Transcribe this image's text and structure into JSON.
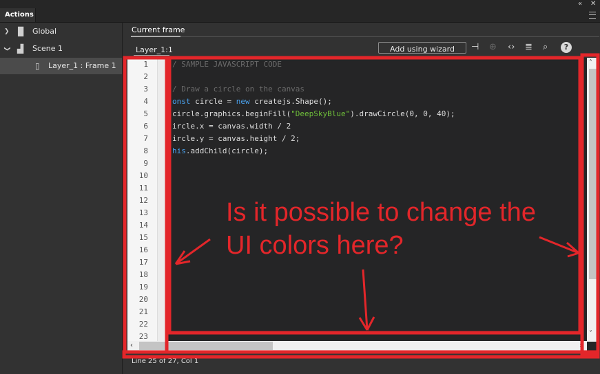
{
  "panel": {
    "tab_label": "Actions",
    "collapse_icon": "«",
    "close_icon": "✕"
  },
  "tree": {
    "items": [
      {
        "label": "Global",
        "chevron": "❯",
        "icon": "document-icon"
      },
      {
        "label": "Scene 1",
        "chevron": "❯",
        "icon": "clapperboard-icon"
      },
      {
        "label": "Layer_1 : Frame 1",
        "icon": "frame-icon"
      }
    ]
  },
  "editor": {
    "tab_label": "Current frame",
    "layer_label": "Layer_1:1",
    "wizard_label": "Add using wizard",
    "help_label": "?",
    "line_numbers": [
      "1",
      "2",
      "3",
      "4",
      "5",
      "6",
      "7",
      "8",
      "9",
      "10",
      "11",
      "12",
      "13",
      "14",
      "15",
      "16",
      "17",
      "18",
      "19",
      "20",
      "21",
      "22",
      "23"
    ],
    "code": {
      "l1": "/ SAMPLE JAVASCRIPT CODE",
      "l3": "/ Draw a circle on the canvas",
      "l4_kw": "onst",
      "l4_mid": " circle = ",
      "l4_kw2": "new",
      "l4_rest": " createjs.Shape();",
      "l5_a": "circle.graphics.beginFill(",
      "l5_str": "\"DeepSkyBlue\"",
      "l5_b": ").drawCircle(0, 0, 40);",
      "l6": "ircle.x = canvas.width / 2",
      "l7": "ircle.y = canvas.height / 2;",
      "l8_kw": "his",
      "l8_rest": ".addChild(circle);"
    },
    "status": "Line 25 of 27, Col 1"
  },
  "annotation": {
    "text": "Is it possible to change the UI colors here?",
    "color": "#e3262a"
  },
  "colors": {
    "editor_bg": "#252526",
    "gutter_bg": "#f5f5f5",
    "keyword": "#4aa3f0",
    "string": "#6fbf3a",
    "comment": "#6b6b6b"
  }
}
